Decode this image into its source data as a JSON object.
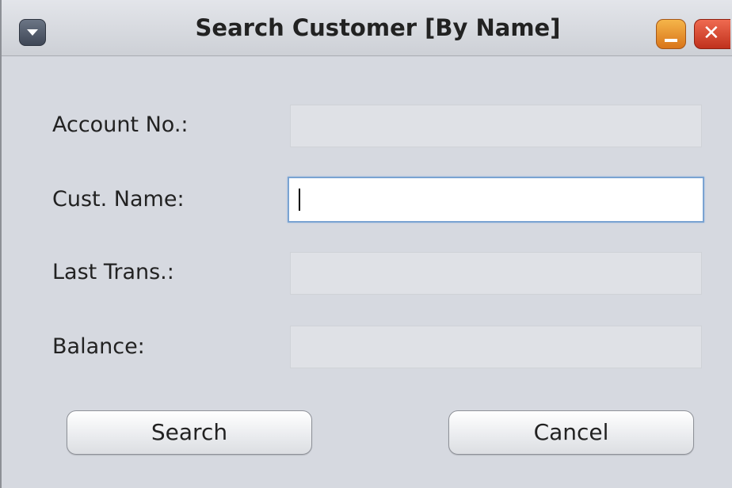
{
  "window": {
    "title": "Search Customer [By Name]",
    "close_glyph": "✕"
  },
  "form": {
    "account_no_label": "Account No.:",
    "account_no_value": "",
    "cust_name_label": "Cust. Name:",
    "cust_name_value": "",
    "last_trans_label": "Last Trans.:",
    "last_trans_value": "",
    "balance_label": "Balance:",
    "balance_value": ""
  },
  "buttons": {
    "search_label": "Search",
    "cancel_label": "Cancel"
  },
  "icons": {
    "menu": "chevron-down-icon",
    "minimize": "minimize-icon",
    "close": "close-icon"
  },
  "colors": {
    "window_bg": "#d6d9e0",
    "minimize_button": "#e8962f",
    "close_button": "#d94b33",
    "focus_ring": "#7aa3d2"
  }
}
